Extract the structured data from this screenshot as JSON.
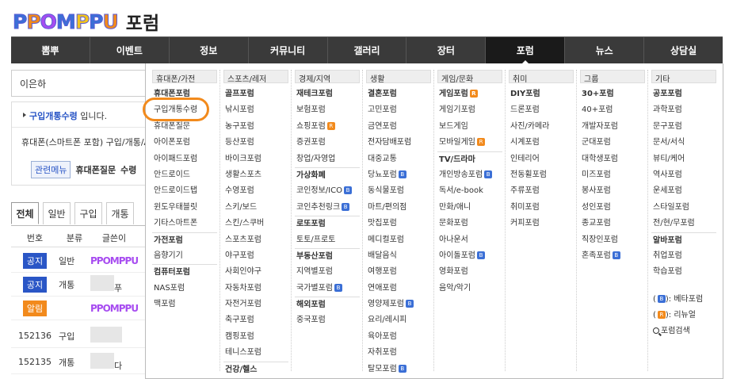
{
  "brand": {
    "logo": "PPOMPPU",
    "title": "포럼"
  },
  "nav": [
    {
      "label": "뽐뿌"
    },
    {
      "label": "이벤트"
    },
    {
      "label": "정보"
    },
    {
      "label": "커뮤니티"
    },
    {
      "label": "갤러리"
    },
    {
      "label": "장터"
    },
    {
      "label": "포럼"
    },
    {
      "label": "뉴스"
    },
    {
      "label": "상담실"
    }
  ],
  "nav_active": "포럼",
  "search": {
    "value": "이은하"
  },
  "notice": {
    "link": "구입개통수령",
    "suffix": "입니다.",
    "desc": "휴대폰(스마트폰 포함) 구입/개통/A",
    "tag": "관련메뉴",
    "menu1": "휴대폰질문",
    "menu2": "수령"
  },
  "tabs": [
    {
      "label": "전체"
    },
    {
      "label": "일반"
    },
    {
      "label": "구입"
    },
    {
      "label": "개통"
    }
  ],
  "table": {
    "headers": [
      "번호",
      "분류",
      "글쓴이"
    ],
    "rows": [
      {
        "badge": "공지",
        "cat": "일반",
        "writer": "PPOMPPU"
      },
      {
        "badge": "공지",
        "cat": "개통",
        "writer": "푸"
      },
      {
        "badge": "알림",
        "cat": "",
        "writer": "PPOMPPU"
      },
      {
        "num": "152136",
        "cat": "구입",
        "writer": ""
      },
      {
        "num": "152135",
        "cat": "개통",
        "writer": "다"
      }
    ]
  },
  "mega": {
    "columns": [
      {
        "head": "휴대폰/가전",
        "items": [
          {
            "t": "휴대폰포럼",
            "h": true
          },
          {
            "t": "구입개통수령"
          },
          {
            "t": "휴대폰질문"
          },
          {
            "t": "아이폰포럼"
          },
          {
            "t": "아이패드포럼"
          },
          {
            "t": "안드로이드"
          },
          {
            "t": "안드로이드탭"
          },
          {
            "t": "윈도우태블릿"
          },
          {
            "t": "기타스마트폰"
          },
          {
            "t": "가전포럼",
            "h": true,
            "sep": true
          },
          {
            "t": "음향기기"
          },
          {
            "t": "컴퓨터포럼",
            "h": true,
            "sep": true
          },
          {
            "t": "NAS포럼"
          },
          {
            "t": "맥포럼"
          }
        ]
      },
      {
        "head": "스포츠/레저",
        "items": [
          {
            "t": "골프포럼",
            "h": true
          },
          {
            "t": "낚시포럼"
          },
          {
            "t": "농구포럼"
          },
          {
            "t": "등산포럼"
          },
          {
            "t": "바이크포럼"
          },
          {
            "t": "생활스포츠"
          },
          {
            "t": "수영포럼"
          },
          {
            "t": "스키/보드"
          },
          {
            "t": "스킨/스쿠버"
          },
          {
            "t": "스포츠포럼"
          },
          {
            "t": "야구포럼"
          },
          {
            "t": "사회인야구"
          },
          {
            "t": "자동차포럼"
          },
          {
            "t": "자전거포럼"
          },
          {
            "t": "축구포럼"
          },
          {
            "t": "캠핑포럼"
          },
          {
            "t": "테니스포럼"
          },
          {
            "t": "건강/헬스",
            "h": true,
            "sep": true
          }
        ]
      },
      {
        "head": "경제/지역",
        "items": [
          {
            "t": "재테크포럼",
            "h": true
          },
          {
            "t": "보험포럼"
          },
          {
            "t": "쇼핑포럼",
            "ico": "r"
          },
          {
            "t": "증권포럼"
          },
          {
            "t": "창업/자영업"
          },
          {
            "t": "가상화폐",
            "h": true,
            "sep": true
          },
          {
            "t": "코인정보/ICO",
            "ico": "b"
          },
          {
            "t": "코인추천링크",
            "ico": "b"
          },
          {
            "t": "로또포럼",
            "h": true,
            "sep": true
          },
          {
            "t": "토토/프로토"
          },
          {
            "t": "부동산포럼",
            "h": true,
            "sep": true
          },
          {
            "t": "지역별포럼"
          },
          {
            "t": "국가별포럼",
            "ico": "b"
          },
          {
            "t": "해외포럼",
            "h": true,
            "sep": true
          },
          {
            "t": "중국포럼"
          }
        ]
      },
      {
        "head": "생활",
        "items": [
          {
            "t": "결혼포럼",
            "h": true
          },
          {
            "t": "고민포럼"
          },
          {
            "t": "금연포럼"
          },
          {
            "t": "전자담배포럼"
          },
          {
            "t": "대중교통"
          },
          {
            "t": "당뇨포럼",
            "ico": "b"
          },
          {
            "t": "동식물포럼"
          },
          {
            "t": "마트/편의점"
          },
          {
            "t": "맛집포럼"
          },
          {
            "t": "메디컬포럼"
          },
          {
            "t": "배달음식"
          },
          {
            "t": "여행포럼"
          },
          {
            "t": "연애포럼"
          },
          {
            "t": "영양제포럼",
            "ico": "b"
          },
          {
            "t": "요리/레시피"
          },
          {
            "t": "육아포럼"
          },
          {
            "t": "자취포럼"
          },
          {
            "t": "탈모포럼",
            "ico": "b"
          }
        ]
      },
      {
        "head": "게임/문화",
        "items": [
          {
            "t": "게임포럼",
            "h": true,
            "ico": "r"
          },
          {
            "t": "게임기포럼"
          },
          {
            "t": "보드게임"
          },
          {
            "t": "모바일게임",
            "ico": "r"
          },
          {
            "t": "TV/드라마",
            "h": true,
            "sep": true
          },
          {
            "t": "개인방송포럼",
            "ico": "b"
          },
          {
            "t": "독서/e-book"
          },
          {
            "t": "만화/애니"
          },
          {
            "t": "문화포럼"
          },
          {
            "t": "아나운서"
          },
          {
            "t": "아이돌포럼",
            "ico": "b"
          },
          {
            "t": "영화포럼"
          },
          {
            "t": "음악/악기"
          }
        ]
      },
      {
        "head": "취미",
        "items": [
          {
            "t": "DIY포럼",
            "h": true
          },
          {
            "t": "드론포럼"
          },
          {
            "t": "사진/카메라"
          },
          {
            "t": "시계포럼"
          },
          {
            "t": "인테리어"
          },
          {
            "t": "전동휠포럼"
          },
          {
            "t": "주류포럼"
          },
          {
            "t": "취미포럼"
          },
          {
            "t": "커피포럼"
          }
        ]
      },
      {
        "head": "그룹",
        "items": [
          {
            "t": "30+포럼",
            "h": true
          },
          {
            "t": "40+포럼"
          },
          {
            "t": "개발자포럼"
          },
          {
            "t": "군대포럼"
          },
          {
            "t": "대학생포럼"
          },
          {
            "t": "미즈포럼"
          },
          {
            "t": "봉사포럼"
          },
          {
            "t": "성인포럼"
          },
          {
            "t": "종교포럼"
          },
          {
            "t": "직장인포럼"
          },
          {
            "t": "혼족포럼",
            "ico": "b"
          }
        ]
      },
      {
        "head": "기타",
        "items": [
          {
            "t": "공포포럼",
            "h": true
          },
          {
            "t": "과학포럼"
          },
          {
            "t": "문구포럼"
          },
          {
            "t": "문서/서식"
          },
          {
            "t": "뷰티/케어"
          },
          {
            "t": "역사포럼"
          },
          {
            "t": "운세포럼"
          },
          {
            "t": "스타일포럼"
          },
          {
            "t": "전/현/무포럼"
          },
          {
            "t": "알바포럼",
            "h": true,
            "sep": true
          },
          {
            "t": "취업포럼"
          },
          {
            "t": "학습포럼"
          }
        ]
      }
    ],
    "legend": {
      "beta": "베타포럼",
      "renew": "리뉴얼",
      "search": "포럼검색"
    }
  },
  "colors": {
    "nav_bg": "#3a3a3a",
    "link": "#2a56c6",
    "badge_blue": "#2a56c6",
    "badge_orange": "#f28a1c",
    "highlight": "#f28a1c"
  }
}
